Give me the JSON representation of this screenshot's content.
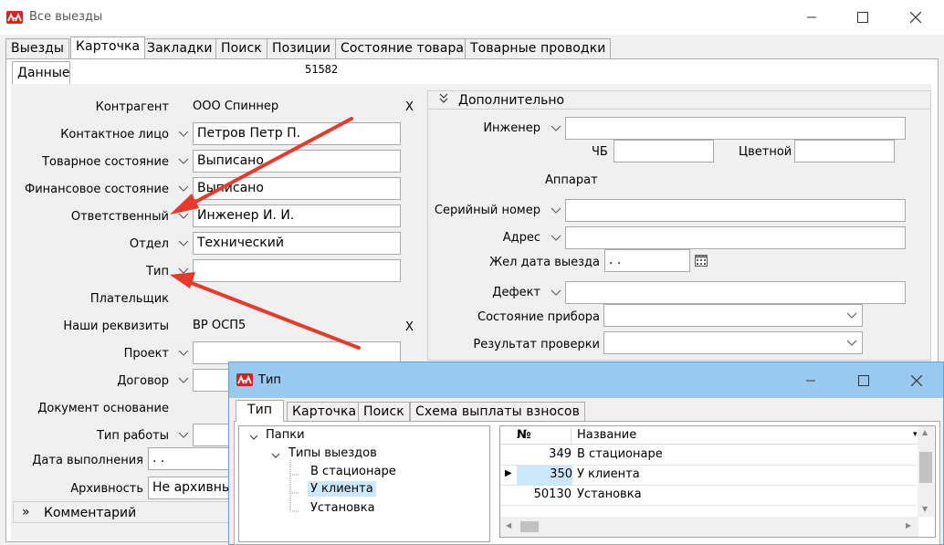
{
  "main_window": {
    "title": "Все выезды",
    "tabs": [
      "Выезды",
      "Карточка",
      "Закладки",
      "Поиск",
      "Позиции",
      "Состояние товара",
      "Товарные проводки"
    ],
    "active_tab": "Карточка",
    "subtab": "Данные",
    "record_number": "51582"
  },
  "form": {
    "counterparty_label": "Контрагент",
    "counterparty_value": "ООО Спиннер",
    "contact_label": "Контактное лицо",
    "contact_value": "Петров Петр П.",
    "goods_state_label": "Товарное состояние",
    "goods_state_value": "Выписано",
    "finance_state_label": "Финансовое состояние",
    "finance_state_value": "Выписано",
    "responsible_label": "Ответственный",
    "responsible_value": "Инженер И. И.",
    "dept_label": "Отдел",
    "dept_value": "Технический",
    "type_label": "Тип",
    "type_value": "",
    "payer_label": "Плательщик",
    "requisites_label": "Наши реквизиты",
    "requisites_value": "ВР ОСП5",
    "project_label": "Проект",
    "contract_label": "Договор",
    "basis_doc_label": "Документ основание",
    "work_type_label": "Тип работы",
    "completion_date_label": "Дата выполнения",
    "completion_date_value": ". .",
    "archive_label": "Архивность",
    "archive_value": "Не архивный",
    "comment_section": "Комментарий",
    "clear_symbol": "X"
  },
  "extra": {
    "header": "Дополнительно",
    "engineer_label": "Инженер",
    "bw_label": "ЧБ",
    "color_label": "Цветной",
    "apparatus_label": "Аппарат",
    "serial_label": "Серийный номер",
    "address_label": "Адрес",
    "desired_date_label": "Жел дата выезда",
    "desired_date_value": ". .",
    "defect_label": "Дефект",
    "device_state_label": "Состояние прибора",
    "check_result_label": "Результат проверки"
  },
  "popup": {
    "title": "Тип",
    "tabs": [
      "Тип",
      "Карточка",
      "Поиск",
      "Схема выплаты взносов"
    ],
    "active_tab": "Тип",
    "tree": {
      "root": "Папки",
      "folder": "Типы выездов",
      "items": [
        "В стационаре",
        "У клиента",
        "Установка"
      ],
      "selected": "У клиента"
    },
    "grid": {
      "columns": [
        "№",
        "Название"
      ],
      "rows": [
        {
          "num": "349",
          "name": "В стационаре"
        },
        {
          "num": "350",
          "name": "У клиента"
        },
        {
          "num": "50130",
          "name": "Установка"
        }
      ],
      "current_row": "350"
    }
  },
  "colors": {
    "logo_red": "#d9211e",
    "arrow_red": "#e8392d",
    "popup_titlebar": "#99c9ef",
    "selection": "#cce8ff"
  }
}
